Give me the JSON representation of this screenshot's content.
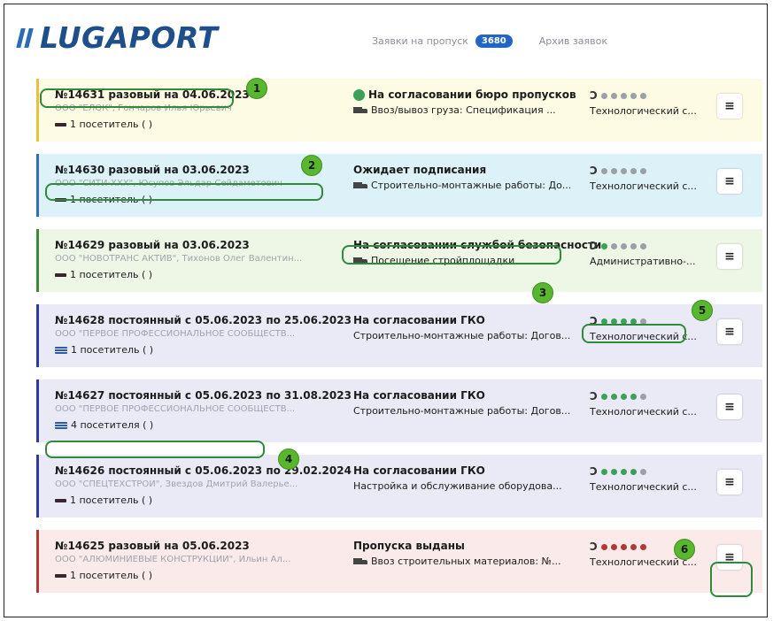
{
  "header": {
    "logo_text": "LUGAPORT",
    "nav_requests_label": "Заявки на пропуск",
    "nav_requests_count": "3680",
    "nav_archive_label": "Архив заявок"
  },
  "cards": [
    {
      "id": "№14631 разовый на 04.06.2023",
      "org": "ООО \"ЕЛОК\", Гончаров Илья Юрьевич",
      "visitors": "1 посетитель (        )",
      "status": "На согласовании бюро пропусков",
      "purpose": "Ввоз/вывоз груза: Спецификация ...",
      "dept": "Технологический с...",
      "bg": "#fdfbe3",
      "border": "#e8c23a",
      "dots": [
        "#9aa0a6",
        "#9aa0a6",
        "#9aa0a6",
        "#9aa0a6",
        "#9aa0a6"
      ]
    },
    {
      "id": "№14630 разовый на 03.06.2023",
      "org": "ООО \"СИТИ-XXX\", Юсупов Эльдар Сейдаметович",
      "visitors": "1 посетитель (        )",
      "status": "Ожидает подписания",
      "purpose": "Строительно-монтажные работы: До...",
      "dept": "Технологический с...",
      "bg": "#ddf1f8",
      "border": "#2f6fb6",
      "dots": [
        "#9aa0a6",
        "#9aa0a6",
        "#9aa0a6",
        "#9aa0a6",
        "#9aa0a6"
      ]
    },
    {
      "id": "№14629 разовый на 03.06.2023",
      "org": "ООО \"НОВОТРАНС АКТИВ\", Тихонов Олег Валентин...",
      "visitors": "1 посетитель (            )",
      "status": "На согласовании службой безопасности",
      "purpose": "Посещение стройплощадки",
      "dept": "Административно-...",
      "bg": "#eef6e6",
      "border": "#3a8a3a",
      "dots": [
        "#3aa05a",
        "#9aa0a6",
        "#9aa0a6",
        "#9aa0a6",
        "#9aa0a6"
      ]
    },
    {
      "id": "№14628 постоянный с 05.06.2023 по 25.06.2023",
      "org": "ООО \"ПЕРВОЕ ПРОФЕССИОНАЛЬНОЕ СООБЩЕСТВ...",
      "visitors": "1 посетитель (        )",
      "status": "На согласовании ГКО",
      "purpose": "Строительно-монтажные работы: Догов...",
      "dept": "Технологический с...",
      "bg": "#e9eaf6",
      "border": "#2e3aa0",
      "dots": [
        "#3aa05a",
        "#3aa05a",
        "#3aa05a",
        "#3aa05a",
        "#9aa0a6"
      ]
    },
    {
      "id": "№14627 постоянный с 05.06.2023 по 31.08.2023",
      "org": "ООО \"ПЕРВОЕ ПРОФЕССИОНАЛЬНОЕ СООБЩЕСТВ...",
      "visitors": "4 посетителя (             )",
      "status": "На согласовании ГКО",
      "purpose": "Строительно-монтажные работы: Догов...",
      "dept": "Технологический с...",
      "bg": "#e9eaf6",
      "border": "#2e3aa0",
      "dots": [
        "#3aa05a",
        "#3aa05a",
        "#3aa05a",
        "#3aa05a",
        "#9aa0a6"
      ]
    },
    {
      "id": "№14626 постоянный с 05.06.2023 по 29.02.2024",
      "org": "ООО \"СПЕЦТЕХСТРОЙ\", Звездов Дмитрий Валерье...",
      "visitors": "1 посетитель (            )",
      "status": "На согласовании ГКО",
      "purpose": "Настройка и обслуживание оборудова...",
      "dept": "Технологический с...",
      "bg": "#e9eaf6",
      "border": "#2e3aa0",
      "dots": [
        "#3aa05a",
        "#3aa05a",
        "#3aa05a",
        "#3aa05a",
        "#9aa0a6"
      ]
    },
    {
      "id": "№14625 разовый на 05.06.2023",
      "org": "ООО \"АЛЮМИНИЕВЫЕ КОНСТРУКЦИИ\", Ильин Ал...",
      "visitors": "1 посетитель (          )",
      "status": "Пропуска выданы",
      "purpose": "Ввоз строительных материалов: №...",
      "dept": "Технологический с...",
      "bg": "#fbeaea",
      "border": "#b23838",
      "dots": [
        "#b23838",
        "#b23838",
        "#b23838",
        "#b23838",
        "#b23838"
      ]
    }
  ],
  "menu_glyph": "≡",
  "history_glyph": "Ↄ",
  "callouts": [
    "1",
    "2",
    "3",
    "4",
    "5",
    "6"
  ]
}
